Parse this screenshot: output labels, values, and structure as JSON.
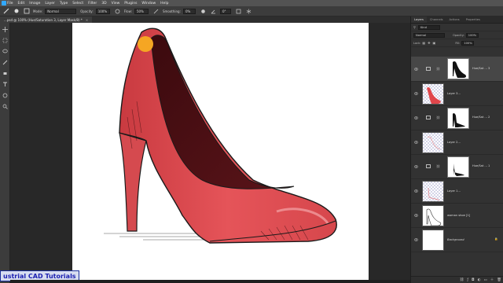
{
  "menubar": {
    "items": [
      "File",
      "Edit",
      "Image",
      "Layer",
      "Type",
      "Select",
      "Filter",
      "3D",
      "View",
      "Plugins",
      "Window",
      "Help"
    ]
  },
  "options": {
    "mode_label": "Mode:",
    "mode_value": "Normal",
    "opacity_label": "Opacity:",
    "opacity_value": "100%",
    "flow_label": "Flow:",
    "flow_value": "50%",
    "smoothing_label": "Smoothing:",
    "smoothing_value": "0%",
    "angle_value": "0°"
  },
  "document": {
    "tab_title": "...psd @ 100% (Hue/Saturation 3, Layer Mask/8) *",
    "close_glyph": "×"
  },
  "panel": {
    "tabs": [
      "Layers",
      "Channels",
      "Actions",
      "Properties"
    ],
    "kind_value": "Kind",
    "blend_value": "Normal",
    "opacity_label": "Opacity:",
    "opacity_value": "100%",
    "lock_label": "Lock:",
    "fill_label": "Fill:",
    "fill_value": "100%"
  },
  "layers": [
    {
      "name": "Hue/Sat ... 3",
      "type": "adjustment",
      "selected": true
    },
    {
      "name": "Layer 3...",
      "type": "pixel",
      "selected": false
    },
    {
      "name": "Hue/Sat ... 2",
      "type": "adjustment",
      "selected": false
    },
    {
      "name": "Layer 2...",
      "type": "pixel",
      "selected": false
    },
    {
      "name": "Hue/Sat ... 1",
      "type": "adjustment",
      "selected": false
    },
    {
      "name": "Layer 1...",
      "type": "pixel",
      "selected": false
    },
    {
      "name": "woman shoe [1]",
      "type": "pixel",
      "selected": false
    },
    {
      "name": "Background",
      "type": "background",
      "selected": false
    }
  ],
  "watermark": "ustrial CAD Tutorials",
  "colors": {
    "accent": "#31a8ff",
    "shoe_red": "#e0464b",
    "shoe_dark": "#4a1015",
    "marker": "#f5a623"
  }
}
